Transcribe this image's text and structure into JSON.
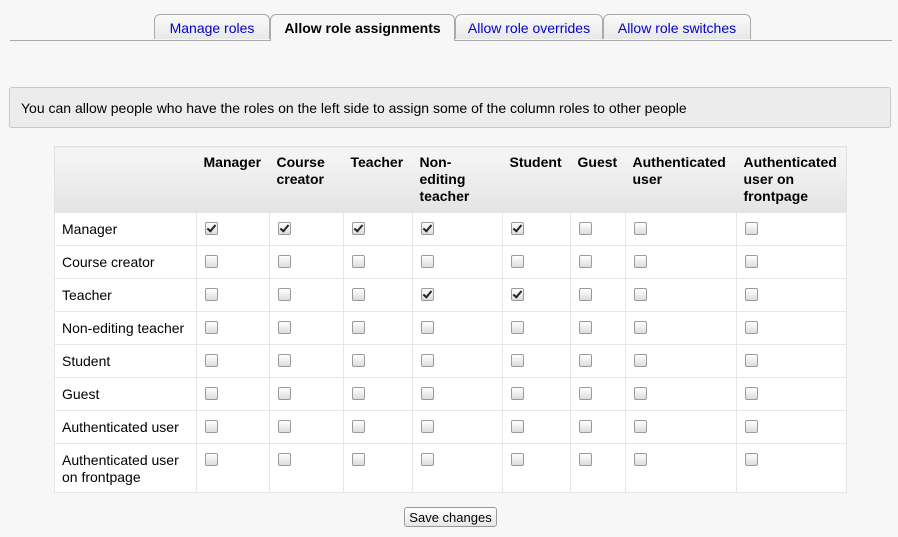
{
  "tabs": [
    {
      "label": "Manage roles",
      "active": false
    },
    {
      "label": "Allow role assignments",
      "active": true
    },
    {
      "label": "Allow role overrides",
      "active": false
    },
    {
      "label": "Allow role switches",
      "active": false
    }
  ],
  "notice": "You can allow people who have the roles on the left side to assign some of the column roles to other people",
  "columns": [
    "Manager",
    "Course creator",
    "Teacher",
    "Non-editing teacher",
    "Student",
    "Guest",
    "Authenticated user",
    "Authenticated user on frontpage"
  ],
  "rows": [
    {
      "role": "Manager",
      "checks": [
        true,
        true,
        true,
        true,
        true,
        false,
        false,
        false
      ]
    },
    {
      "role": "Course creator",
      "checks": [
        false,
        false,
        false,
        false,
        false,
        false,
        false,
        false
      ]
    },
    {
      "role": "Teacher",
      "checks": [
        false,
        false,
        false,
        true,
        true,
        false,
        false,
        false
      ]
    },
    {
      "role": "Non-editing teacher",
      "checks": [
        false,
        false,
        false,
        false,
        false,
        false,
        false,
        false
      ]
    },
    {
      "role": "Student",
      "checks": [
        false,
        false,
        false,
        false,
        false,
        false,
        false,
        false
      ]
    },
    {
      "role": "Guest",
      "checks": [
        false,
        false,
        false,
        false,
        false,
        false,
        false,
        false
      ]
    },
    {
      "role": "Authenticated user",
      "checks": [
        false,
        false,
        false,
        false,
        false,
        false,
        false,
        false
      ]
    },
    {
      "role": "Authenticated user on frontpage",
      "checks": [
        false,
        false,
        false,
        false,
        false,
        false,
        false,
        false
      ]
    }
  ],
  "save_label": "Save changes"
}
